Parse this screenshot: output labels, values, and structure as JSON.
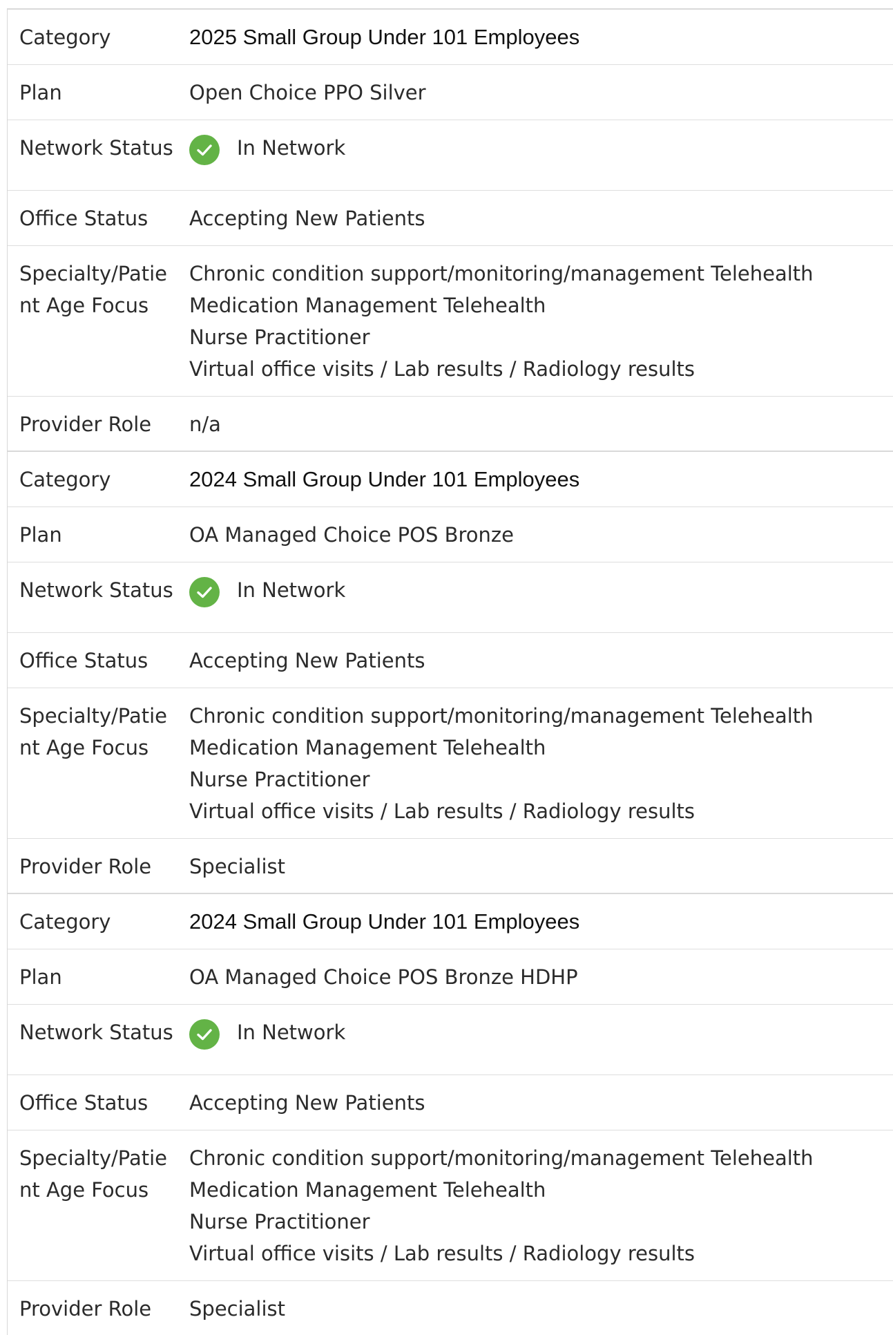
{
  "labels": {
    "category": "Category",
    "plan": "Plan",
    "network_status": "Network Status",
    "office_status": "Office Status",
    "specialty_line1": "Specialty/Patie",
    "specialty_line2": "nt Age Focus",
    "provider_role": "Provider Role"
  },
  "entries": [
    {
      "category": "2025 Small Group Under 101 Employees",
      "plan": "Open Choice PPO Silver",
      "network_status": {
        "icon": "check-circle-icon",
        "color": "#63b346",
        "text": "In Network"
      },
      "office_status": "Accepting New Patients",
      "specialty": [
        "Chronic condition support/monitoring/management Telehealth",
        "Medication Management Telehealth",
        "Nurse Practitioner",
        "Virtual office visits / Lab results / Radiology results"
      ],
      "provider_role": "n/a"
    },
    {
      "category": "2024 Small Group Under 101 Employees",
      "plan": "OA Managed Choice POS Bronze",
      "network_status": {
        "icon": "check-circle-icon",
        "color": "#63b346",
        "text": "In Network"
      },
      "office_status": "Accepting New Patients",
      "specialty": [
        "Chronic condition support/monitoring/management Telehealth",
        "Medication Management Telehealth",
        "Nurse Practitioner",
        "Virtual office visits / Lab results / Radiology results"
      ],
      "provider_role": "Specialist"
    },
    {
      "category": "2024 Small Group Under 101 Employees",
      "plan": "OA Managed Choice POS Bronze HDHP",
      "network_status": {
        "icon": "check-circle-icon",
        "color": "#63b346",
        "text": "In Network"
      },
      "office_status": "Accepting New Patients",
      "specialty": [
        "Chronic condition support/monitoring/management Telehealth",
        "Medication Management Telehealth",
        "Nurse Practitioner",
        "Virtual office visits / Lab results / Radiology results"
      ],
      "provider_role": "Specialist"
    }
  ]
}
